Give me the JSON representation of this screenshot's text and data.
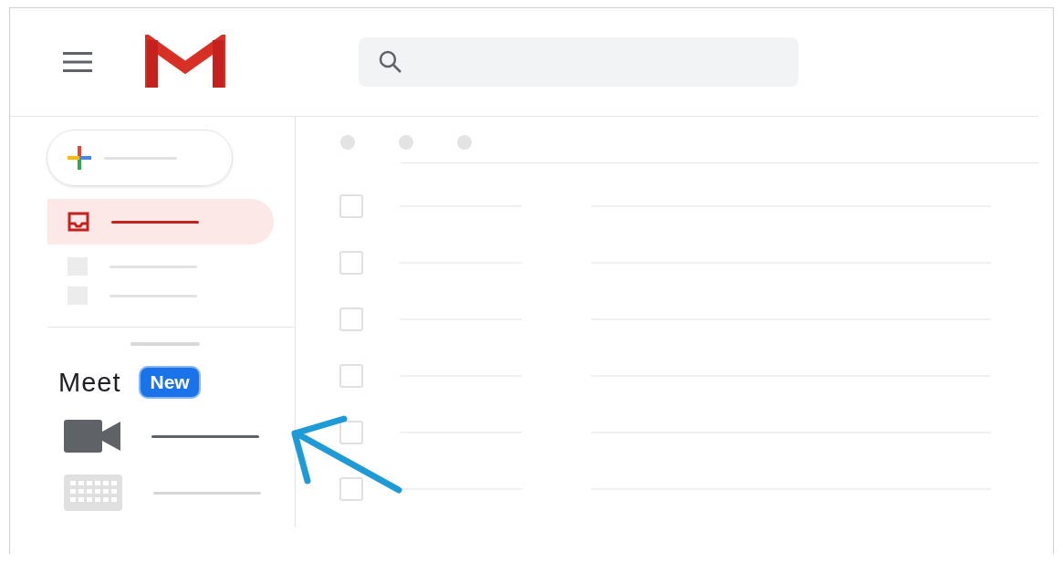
{
  "nav_items": [
    {
      "kind": "inbox",
      "selected": true
    },
    {
      "kind": "plain",
      "selected": false
    },
    {
      "kind": "plain",
      "selected": false
    }
  ],
  "meet": {
    "title": "Meet",
    "badge": "New",
    "items": [
      {
        "kind": "video"
      },
      {
        "kind": "keyboard"
      }
    ]
  },
  "message_rows": [
    {
      "checked": false
    },
    {
      "checked": false
    },
    {
      "checked": false
    },
    {
      "checked": false
    },
    {
      "checked": false
    },
    {
      "checked": false
    }
  ]
}
